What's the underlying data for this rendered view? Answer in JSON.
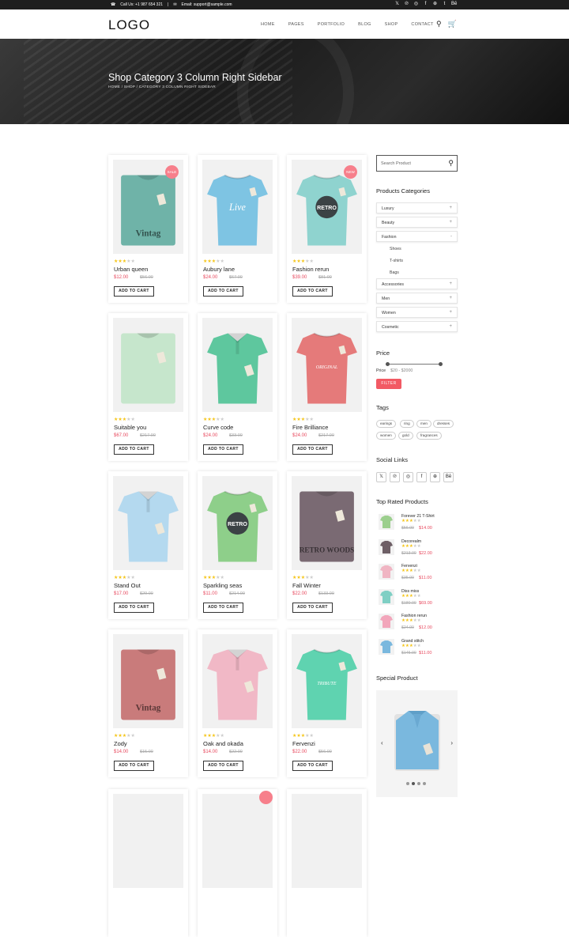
{
  "topbar": {
    "phone": "Call Us: +1 987 654 321",
    "sep": "|",
    "email": "Email: support@sample.com",
    "socials": [
      "twitter-icon",
      "pinterest-icon",
      "instagram-icon",
      "facebook-icon",
      "dribbble-icon",
      "tumblr-icon",
      "behance-icon"
    ],
    "social_glyphs": [
      "𝕏",
      "℗",
      "◎",
      "f",
      "⊕",
      "t",
      "Bē"
    ]
  },
  "nav": {
    "logo": "LOGO",
    "items": [
      "HOME",
      "PAGES",
      "PORTFOLIO",
      "BLOG",
      "SHOP",
      "CONTACT"
    ]
  },
  "hero": {
    "title": "Shop Category 3 Column Right Sidebar",
    "breadcrumb": "HOME / SHOP / CATEGORY 3 COLUMN RIGHT SIDEBAR"
  },
  "products": [
    {
      "name": "Urban queen",
      "price": "$12.00",
      "old": "$56.00",
      "rating": 3,
      "badge": "SALE",
      "color": "#6fb3a8",
      "style": "folded",
      "text": "Vintag"
    },
    {
      "name": "Aubury lane",
      "price": "$24.00",
      "old": "$67.00",
      "rating": 3,
      "badge": "",
      "color": "#7ec4e3",
      "style": "tee",
      "text": "Live"
    },
    {
      "name": "Fashion rerun",
      "price": "$39.00",
      "old": "$81.00",
      "rating": 3,
      "badge": "NEW",
      "color": "#8fd3cf",
      "style": "tee",
      "text": "RETRO"
    },
    {
      "name": "Suitable you",
      "price": "$67.00",
      "old": "$217.00",
      "rating": 3,
      "badge": "",
      "color": "#c6e6cc",
      "style": "folded",
      "text": ""
    },
    {
      "name": "Curve code",
      "price": "$24.00",
      "old": "$33.00",
      "rating": 3,
      "badge": "",
      "color": "#5ec79e",
      "style": "polo",
      "text": ""
    },
    {
      "name": "Fire Brilliance",
      "price": "$24.00",
      "old": "$217.00",
      "rating": 3,
      "badge": "",
      "color": "#e57a7a",
      "style": "tee",
      "text": "ORIGINAL"
    },
    {
      "name": "Stand Out",
      "price": "$17.00",
      "old": "$29.00",
      "rating": 3,
      "badge": "",
      "color": "#b4d9ef",
      "style": "polo",
      "text": ""
    },
    {
      "name": "Sparkling seas",
      "price": "$11.00",
      "old": "$214.00",
      "rating": 3,
      "badge": "",
      "color": "#8ecf8a",
      "style": "tee",
      "text": "RETRO"
    },
    {
      "name": "Fall Winter",
      "price": "$22.00",
      "old": "$133.00",
      "rating": 3,
      "badge": "",
      "color": "#7a6a73",
      "style": "folded",
      "text": "RETRO WOODS"
    },
    {
      "name": "Zody",
      "price": "$14.00",
      "old": "$15.00",
      "rating": 3,
      "badge": "",
      "color": "#c97b7b",
      "style": "folded",
      "text": "Vintag"
    },
    {
      "name": "Oak and okada",
      "price": "$14.00",
      "old": "$22.00",
      "rating": 3,
      "badge": "",
      "color": "#f1b8c6",
      "style": "polo",
      "text": ""
    },
    {
      "name": "Fervenzi",
      "price": "$22.00",
      "old": "$56.00",
      "rating": 3,
      "badge": "",
      "color": "#5fd3b0",
      "style": "tee",
      "text": "TRIBUTE"
    }
  ],
  "cart_label": "ADD TO CART",
  "sidebar": {
    "search_placeholder": "Search Product",
    "categories_title": "Products Categories",
    "categories": [
      {
        "label": "Luxury",
        "sign": "+"
      },
      {
        "label": "Beauty",
        "sign": "+"
      },
      {
        "label": "Fashion",
        "sign": "-"
      },
      {
        "label": "Accessories",
        "sign": "+"
      },
      {
        "label": "Men",
        "sign": "+"
      },
      {
        "label": "Women",
        "sign": "+"
      },
      {
        "label": "Cosmetic",
        "sign": "+"
      }
    ],
    "subcategories": [
      "Shoes",
      "T-shirts",
      "Bags"
    ],
    "price_title": "Price",
    "price_label": "Price",
    "price_range": "$20 - $2000",
    "filter_label": "FILTER",
    "tags_title": "Tags",
    "tags": [
      "earings",
      "ring",
      "men",
      "dresses",
      "women",
      "gold",
      "fragrances"
    ],
    "social_title": "Social Links",
    "social_glyphs": [
      "𝕏",
      "℗",
      "◎",
      "f",
      "⊕",
      "Bē"
    ],
    "top_title": "Top Rated Products",
    "top_products": [
      {
        "name": "Forever 21 T-Shirt",
        "old": "$56.00",
        "price": "$14.00",
        "rating": 3,
        "color": "#9ccf8e"
      },
      {
        "name": "Decorealm",
        "old": "$213.00",
        "price": "$22.00",
        "rating": 3,
        "color": "#6e5f66"
      },
      {
        "name": "Fervenzi",
        "old": "$35.00",
        "price": "$11.00",
        "rating": 3,
        "color": "#f0b5c3"
      },
      {
        "name": "Diss miss",
        "old": "$180.00",
        "price": "$69.00",
        "rating": 3,
        "color": "#7fcfc4"
      },
      {
        "name": "Fashion rerun",
        "old": "$24.00",
        "price": "$12.00",
        "rating": 3,
        "color": "#f2a6bb"
      },
      {
        "name": "Grand stitch",
        "old": "$145.00",
        "price": "$11.00",
        "rating": 3,
        "color": "#7ab8de"
      }
    ],
    "special_title": "Special Product"
  }
}
